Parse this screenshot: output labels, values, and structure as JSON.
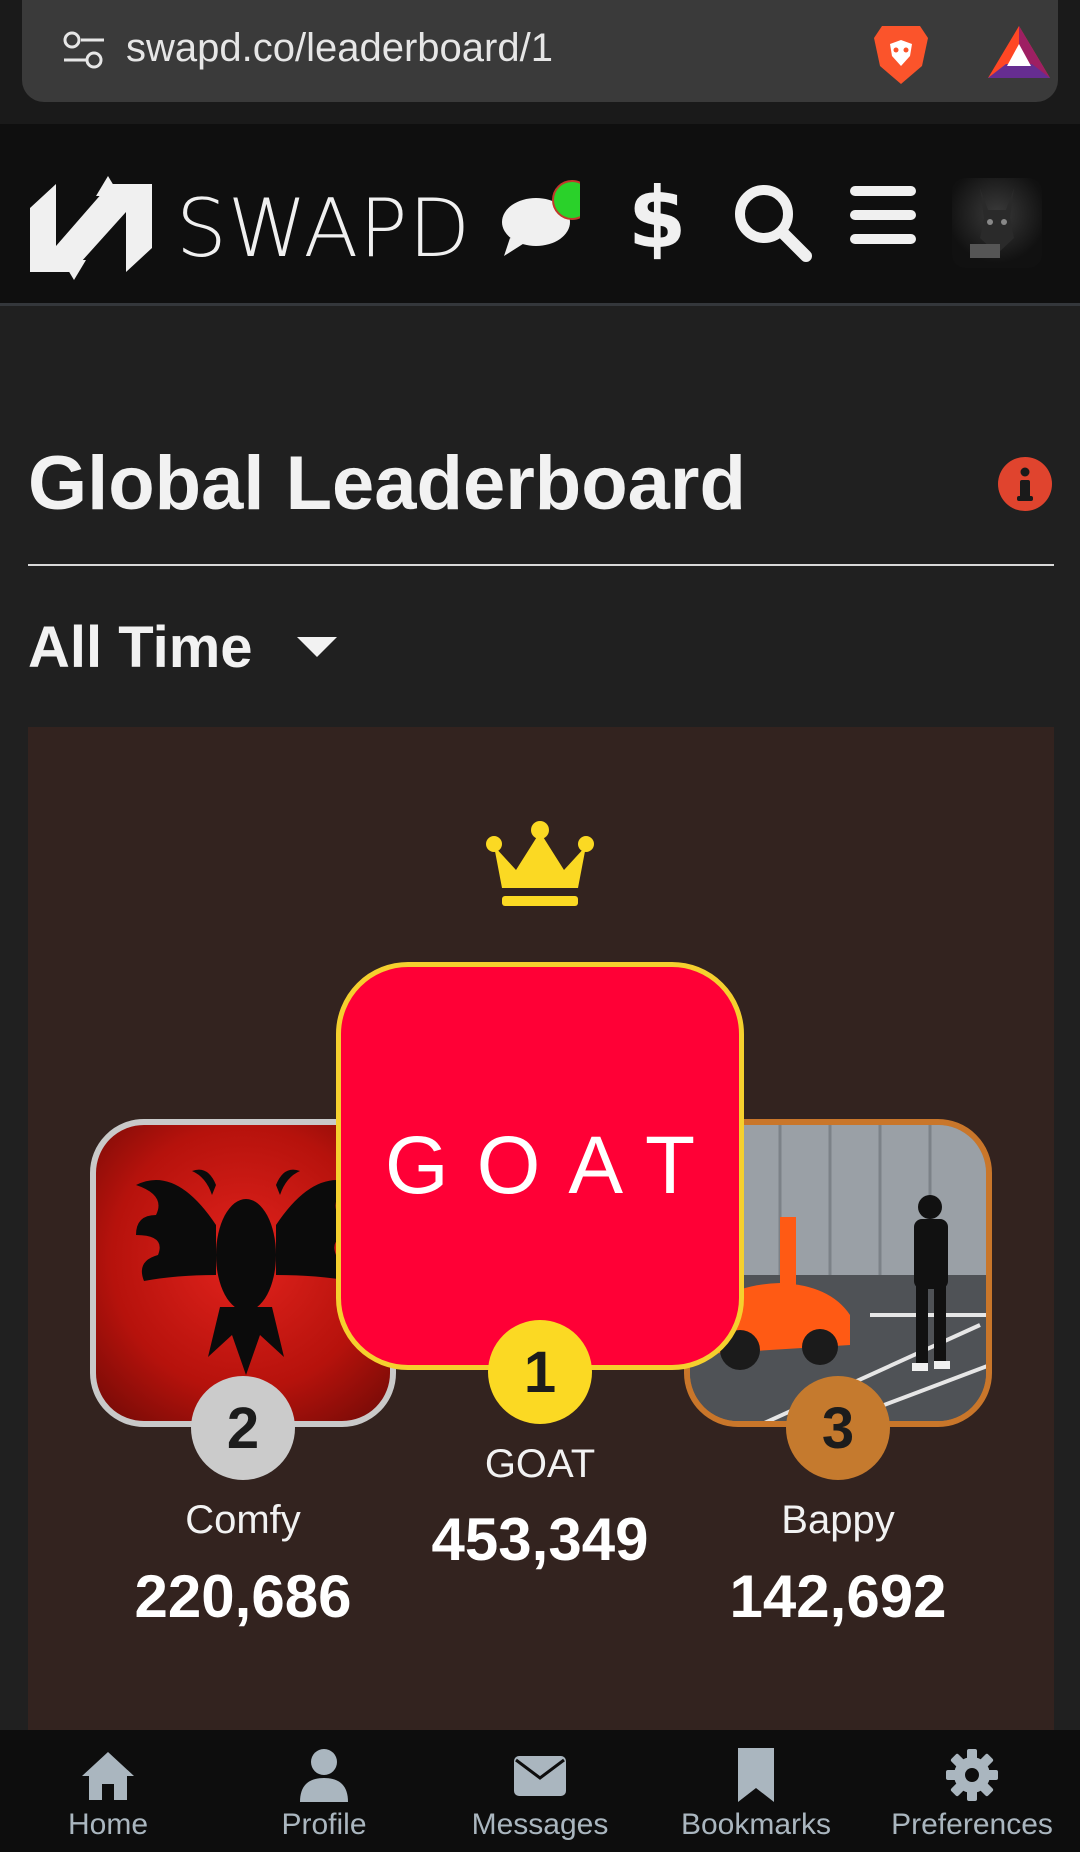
{
  "browser": {
    "url": "swapd.co/leaderboard/1",
    "icons": [
      "tune-icon",
      "brave-lion-icon",
      "bat-triangle-icon"
    ]
  },
  "header": {
    "logo_text": "SWAPD",
    "icons": [
      "swapd-logo-icon",
      "chat-icon",
      "dollar-icon",
      "search-icon",
      "menu-icon"
    ],
    "dollar_glyph": "$",
    "chat_notification_color": "#2ad12a"
  },
  "page": {
    "title": "Global Leaderboard",
    "filter": {
      "selected": "All Time"
    }
  },
  "podium": {
    "first": {
      "rank": "1",
      "name": "GOAT",
      "score": "453,349",
      "avatar_text": "GOAT",
      "color": "#fbd923"
    },
    "second": {
      "rank": "2",
      "name": "Comfy",
      "score": "220,686",
      "color": "#cbcbcb"
    },
    "third": {
      "rank": "3",
      "name": "Bappy",
      "score": "142,692",
      "color": "#c57a2e"
    }
  },
  "bottom_nav": {
    "items": [
      {
        "label": "Home",
        "icon": "home-icon"
      },
      {
        "label": "Profile",
        "icon": "user-icon"
      },
      {
        "label": "Messages",
        "icon": "envelope-icon"
      },
      {
        "label": "Bookmarks",
        "icon": "bookmark-icon"
      },
      {
        "label": "Preferences",
        "icon": "gear-icon"
      }
    ]
  },
  "colors": {
    "background": "#202020",
    "card": "#33231f",
    "goat_tile": "#ff0036",
    "info_icon": "#e0442e"
  }
}
